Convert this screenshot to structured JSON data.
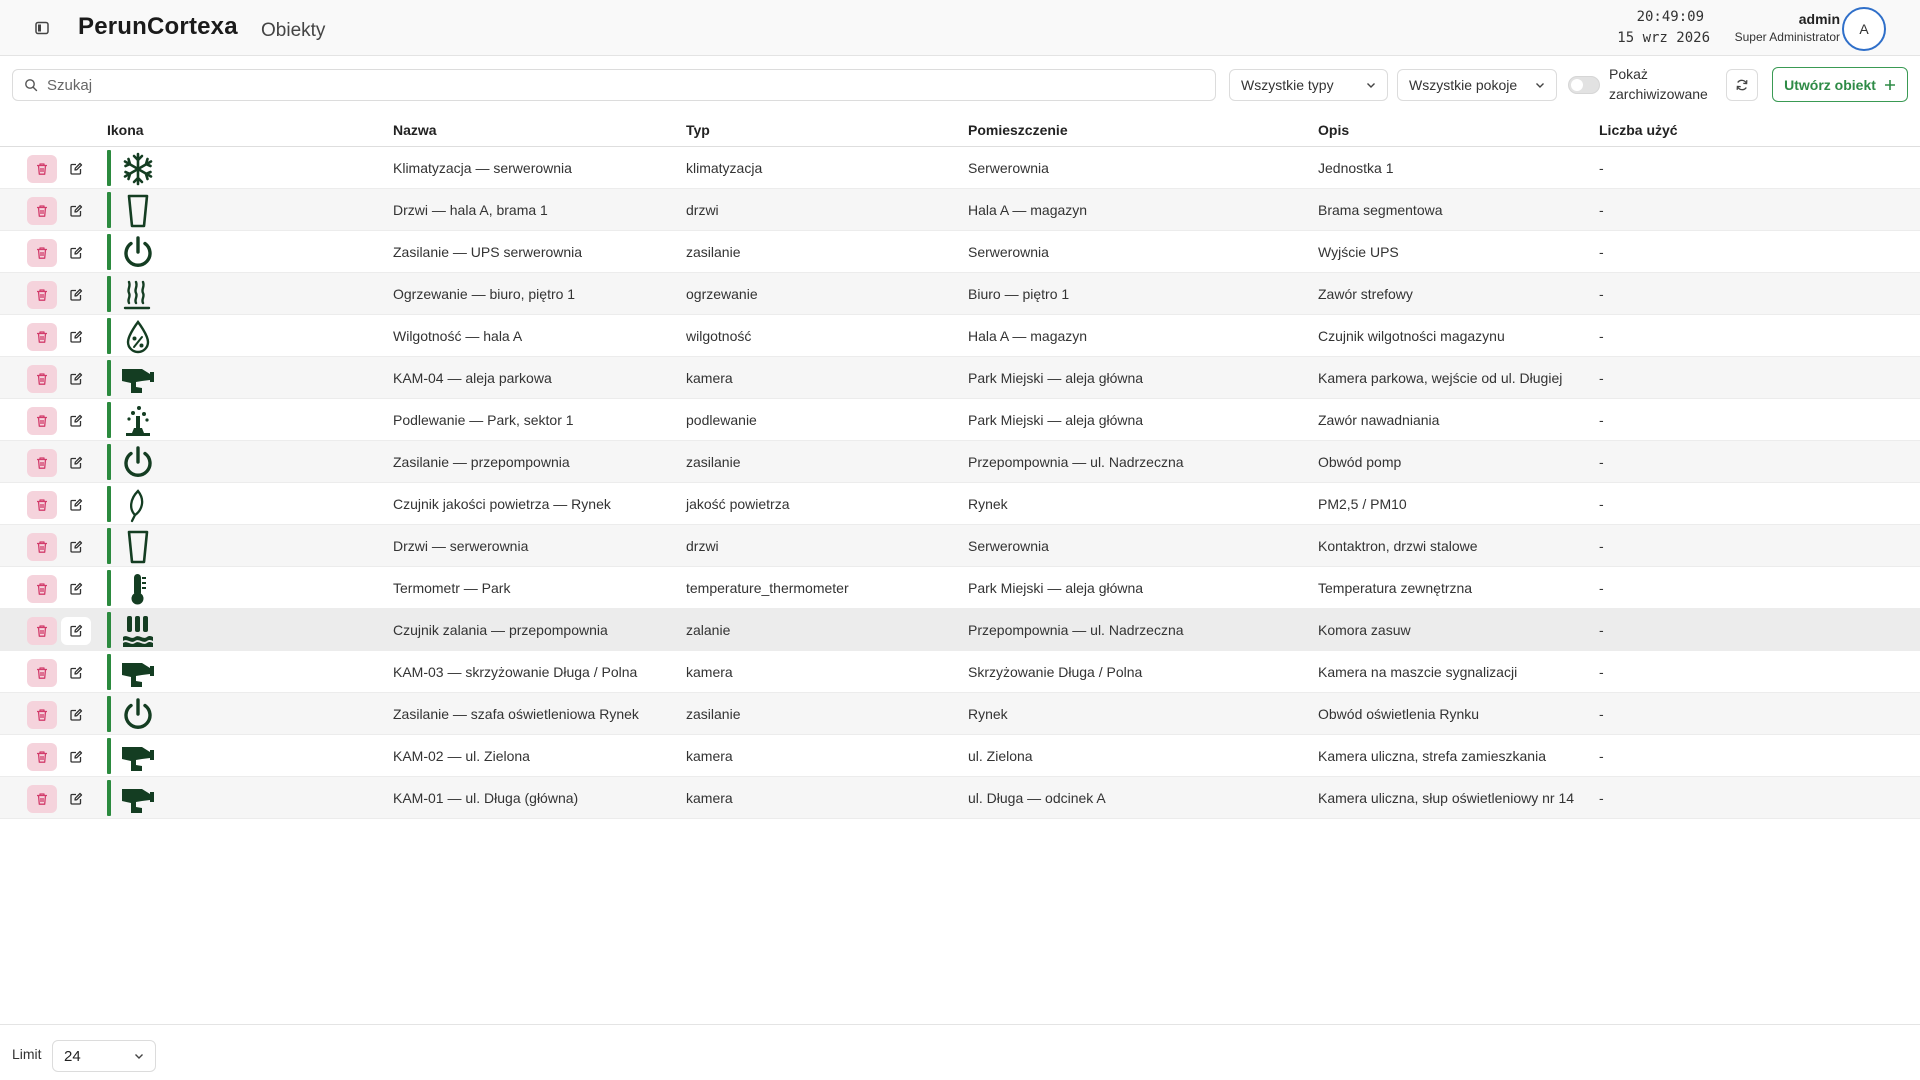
{
  "header": {
    "brand": "PerunCortexa",
    "page_title": "Obiekty",
    "time": "20:49:09",
    "date": "15 wrz 2026",
    "user_name": "admin",
    "user_role": "Super Administrator",
    "avatar_initial": "A"
  },
  "toolbar": {
    "search_placeholder": "Szukaj",
    "type_filter": "Wszystkie typy",
    "room_filter": "Wszystkie pokoje",
    "show_archived_label": "Pokaż zarchiwizowane",
    "show_archived": false,
    "create_label": "Utwórz obiekt"
  },
  "table": {
    "columns": {
      "icon": "Ikona",
      "name": "Nazwa",
      "type": "Typ",
      "room": "Pomieszczenie",
      "description": "Opis",
      "usage": "Liczba użyć"
    },
    "rows": [
      {
        "icon": "snowflake-icon",
        "name": "Klimatyzacja — serwerownia",
        "type": "klimatyzacja",
        "room": "Serwerownia",
        "description": "Jednostka 1",
        "usage": "-"
      },
      {
        "icon": "door-icon",
        "name": "Drzwi — hala A, brama 1",
        "type": "drzwi",
        "room": "Hala A — magazyn",
        "description": "Brama segmentowa",
        "usage": "-"
      },
      {
        "icon": "power-icon",
        "name": "Zasilanie — UPS serwerownia",
        "type": "zasilanie",
        "room": "Serwerownia",
        "description": "Wyjście UPS",
        "usage": "-"
      },
      {
        "icon": "heating-icon",
        "name": "Ogrzewanie — biuro, piętro 1",
        "type": "ogrzewanie",
        "room": "Biuro — piętro 1",
        "description": "Zawór strefowy",
        "usage": "-"
      },
      {
        "icon": "humidity-icon",
        "name": "Wilgotność — hala A",
        "type": "wilgotność",
        "room": "Hala A — magazyn",
        "description": "Czujnik wilgotności magazynu",
        "usage": "-"
      },
      {
        "icon": "camera-icon",
        "name": "KAM-04 — aleja parkowa",
        "type": "kamera",
        "room": "Park Miejski — aleja główna",
        "description": "Kamera parkowa, wejście od ul. Długiej",
        "usage": "-"
      },
      {
        "icon": "watering-icon",
        "name": "Podlewanie — Park, sektor 1",
        "type": "podlewanie",
        "room": "Park Miejski — aleja główna",
        "description": "Zawór nawadniania",
        "usage": "-"
      },
      {
        "icon": "power-icon",
        "name": "Zasilanie — przepompownia",
        "type": "zasilanie",
        "room": "Przepompownia — ul. Nadrzeczna",
        "description": "Obwód pomp",
        "usage": "-"
      },
      {
        "icon": "leaf-icon",
        "name": "Czujnik jakości powietrza — Rynek",
        "type": "jakość powietrza",
        "room": "Rynek",
        "description": "PM2,5 / PM10",
        "usage": "-"
      },
      {
        "icon": "door-icon",
        "name": "Drzwi — serwerownia",
        "type": "drzwi",
        "room": "Serwerownia",
        "description": "Kontaktron, drzwi stalowe",
        "usage": "-"
      },
      {
        "icon": "thermometer-icon",
        "name": "Termometr — Park",
        "type": "temperature_thermometer",
        "room": "Park Miejski — aleja główna",
        "description": "Temperatura zewnętrzna",
        "usage": "-"
      },
      {
        "icon": "flood-icon",
        "name": "Czujnik zalania — przepompownia",
        "type": "zalanie",
        "room": "Przepompownia — ul. Nadrzeczna",
        "description": "Komora zasuw",
        "usage": "-"
      },
      {
        "icon": "camera-icon",
        "name": "KAM-03 — skrzyżowanie Długa / Polna",
        "type": "kamera",
        "room": "Skrzyżowanie Długa / Polna",
        "description": "Kamera na maszcie sygnalizacji",
        "usage": "-"
      },
      {
        "icon": "power-icon",
        "name": "Zasilanie — szafa oświetleniowa Rynek",
        "type": "zasilanie",
        "room": "Rynek",
        "description": "Obwód oświetlenia Rynku",
        "usage": "-"
      },
      {
        "icon": "camera-icon",
        "name": "KAM-02 — ul. Zielona",
        "type": "kamera",
        "room": "ul. Zielona",
        "description": "Kamera uliczna, strefa zamieszkania",
        "usage": "-"
      },
      {
        "icon": "camera-icon",
        "name": "KAM-01 — ul. Długa (główna)",
        "type": "kamera",
        "room": "ul. Długa — odcinek A",
        "description": "Kamera uliczna, słup oświetleniowy nr 14",
        "usage": "-"
      }
    ],
    "highlighted_row": 11
  },
  "footer": {
    "limit_label": "Limit",
    "limit_value": "24"
  },
  "colors": {
    "icon": "#143d22",
    "status": "#2b8a3e",
    "delete_bg": "#f5d3dc",
    "delete_icon": "#d23c6b",
    "accent_green": "#2e8b46",
    "avatar_border": "#2f6fc9"
  }
}
